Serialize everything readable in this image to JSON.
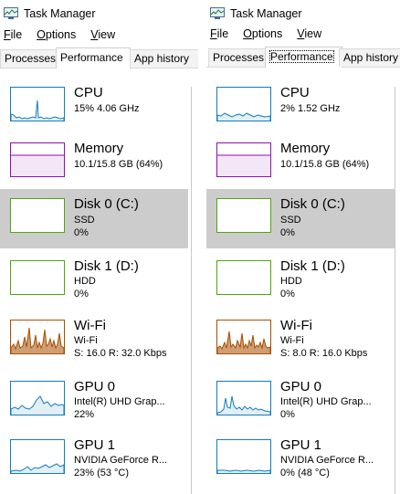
{
  "left": {
    "title": "Task Manager",
    "menu": [
      {
        "ul": "F",
        "rest": "ile"
      },
      {
        "ul": "O",
        "rest": "ptions"
      },
      {
        "ul": "V",
        "rest": "iew"
      }
    ],
    "tabs": [
      "Processes",
      "Performance",
      "App history"
    ],
    "items": [
      {
        "name": "CPU",
        "line1": "15% 4.06 GHz",
        "line2": ""
      },
      {
        "name": "Memory",
        "line1": "10.1/15.8 GB (64%)",
        "line2": ""
      },
      {
        "name": "Disk 0 (C:)",
        "line1": "SSD",
        "line2": "0%"
      },
      {
        "name": "Disk 1 (D:)",
        "line1": "HDD",
        "line2": "0%"
      },
      {
        "name": "Wi-Fi",
        "line1": "Wi-Fi",
        "line2": "S: 16.0  R: 32.0 Kbps"
      },
      {
        "name": "GPU 0",
        "line1": "Intel(R) UHD Grap...",
        "line2": "22%"
      },
      {
        "name": "GPU 1",
        "line1": "NVIDIA GeForce R...",
        "line2": "23% (53 °C)"
      }
    ]
  },
  "right": {
    "title": "Task Manager",
    "menu": [
      {
        "ul": "F",
        "rest": "ile"
      },
      {
        "ul": "O",
        "rest": "ptions"
      },
      {
        "ul": "V",
        "rest": "iew"
      }
    ],
    "tabs": [
      "Processes",
      "Performance",
      "App history"
    ],
    "items": [
      {
        "name": "CPU",
        "line1": "2% 1.52 GHz",
        "line2": ""
      },
      {
        "name": "Memory",
        "line1": "10.1/15.8 GB (64%)",
        "line2": ""
      },
      {
        "name": "Disk 0 (C:)",
        "line1": "SSD",
        "line2": "0%"
      },
      {
        "name": "Disk 1 (D:)",
        "line1": "HDD",
        "line2": "0%"
      },
      {
        "name": "Wi-Fi",
        "line1": "Wi-Fi",
        "line2": "S: 8.0  R: 16.0 Kbps"
      },
      {
        "name": "GPU 0",
        "line1": "Intel(R) UHD Grap...",
        "line2": "0%"
      },
      {
        "name": "GPU 1",
        "line1": "NVIDIA GeForce R...",
        "line2": "0% (48 °C)"
      }
    ]
  },
  "colors": {
    "cpu": "#117dbb",
    "memory": "#8b12ae",
    "disk": "#4da60c",
    "wifi": "#a74f01",
    "gpu": "#117dbb",
    "selected_bg": "#cccccc"
  }
}
